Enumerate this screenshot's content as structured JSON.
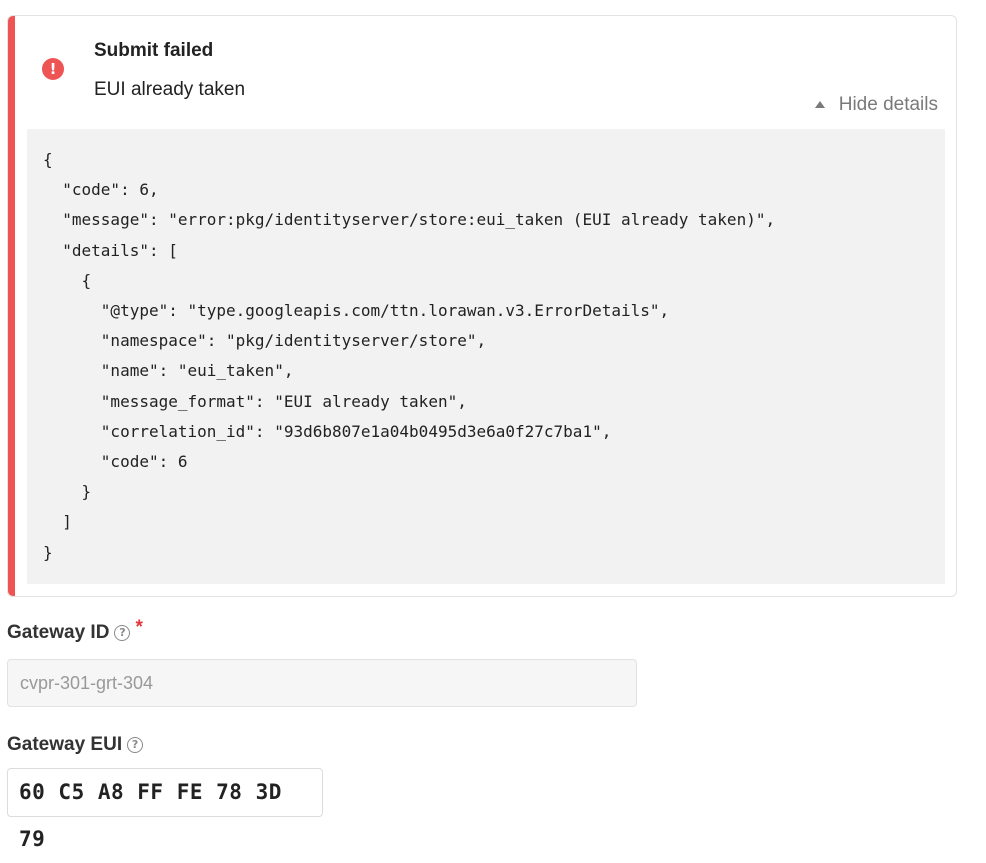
{
  "error": {
    "title": "Submit failed",
    "message": "EUI already taken",
    "toggle_label": "Hide details",
    "details_json": "{\n  \"code\": 6,\n  \"message\": \"error:pkg/identityserver/store:eui_taken (EUI already taken)\",\n  \"details\": [\n    {\n      \"@type\": \"type.googleapis.com/ttn.lorawan.v3.ErrorDetails\",\n      \"namespace\": \"pkg/identityserver/store\",\n      \"name\": \"eui_taken\",\n      \"message_format\": \"EUI already taken\",\n      \"correlation_id\": \"93d6b807e1a04b0495d3e6a0f27c7ba1\",\n      \"code\": 6\n    }\n  ]\n}",
    "icon": "exclamation-circle-icon",
    "accent_color": "#ee5454"
  },
  "form": {
    "gateway_id": {
      "label": "Gateway ID",
      "required_marker": "*",
      "help_icon": "question-circle-icon",
      "value": "cvpr-301-grt-304"
    },
    "gateway_eui": {
      "label": "Gateway EUI",
      "help_icon": "question-circle-icon",
      "value": "60 C5 A8 FF FE 78 3D 79"
    }
  }
}
